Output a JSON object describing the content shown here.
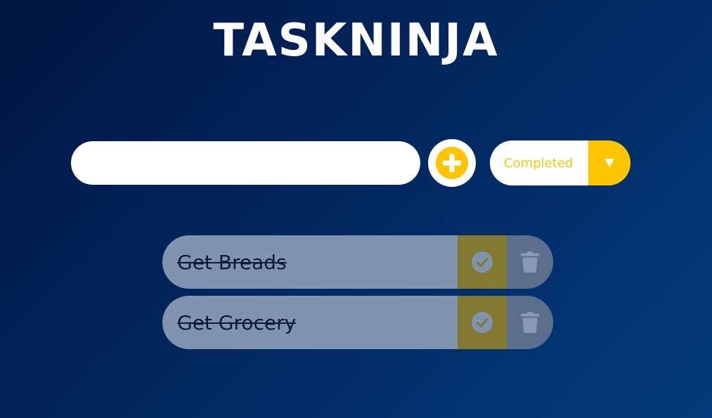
{
  "app": {
    "title": "TASKNINJA"
  },
  "form": {
    "input_value": "",
    "input_placeholder": "",
    "add_icon": "plus-circle-icon",
    "filter_selected": "Completed",
    "filter_arrow": "▼"
  },
  "todos": [
    {
      "text": "Get Breads",
      "completed": true,
      "complete_icon": "check-circle-icon",
      "delete_icon": "trash-icon"
    },
    {
      "text": "Get Grocery",
      "completed": true,
      "complete_icon": "check-circle-icon",
      "delete_icon": "trash-icon"
    }
  ],
  "colors": {
    "background_start": "#011542",
    "background_end": "#033c7c",
    "accent": "#fdc500",
    "todo_background": "#8093af",
    "complete_button": "#827a32",
    "trash_button": "#5b6e8c",
    "text_dark": "#0d1a3a",
    "white": "#ffffff"
  }
}
